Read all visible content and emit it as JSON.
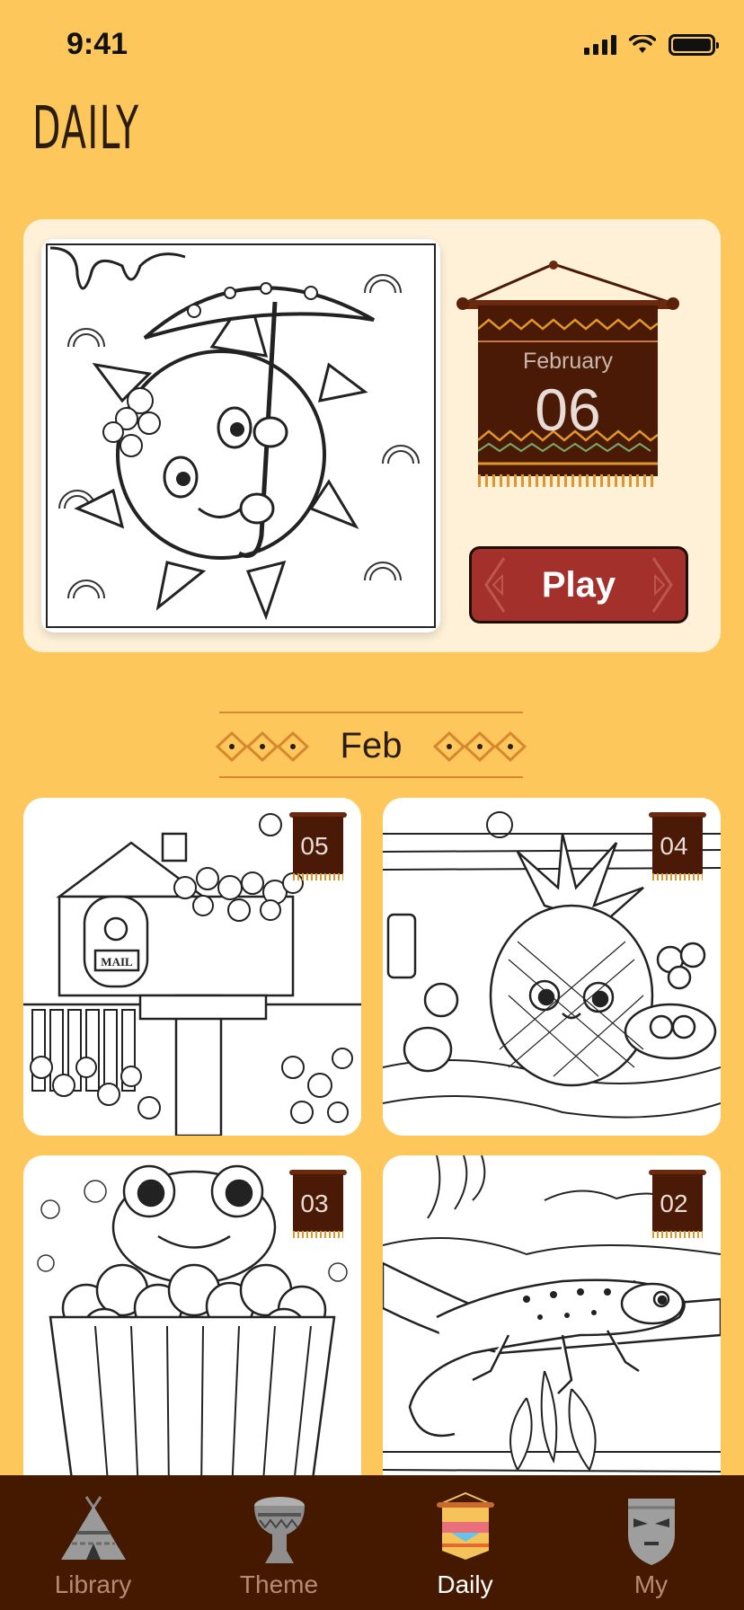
{
  "status_bar": {
    "time": "9:41"
  },
  "page": {
    "title": "DAILY"
  },
  "featured": {
    "month": "February",
    "day": "06",
    "play_label": "Play"
  },
  "section": {
    "label": "Feb"
  },
  "tiles": [
    {
      "day": "05",
      "subject": "mailbox with flowers",
      "sign_text": "MAIL"
    },
    {
      "day": "04",
      "subject": "pineapple character"
    },
    {
      "day": "03",
      "subject": "frog in popcorn"
    },
    {
      "day": "02",
      "subject": "gecko on branch"
    }
  ],
  "tabs": [
    {
      "label": "Library",
      "icon": "tent-icon",
      "active": false
    },
    {
      "label": "Theme",
      "icon": "drum-icon",
      "active": false
    },
    {
      "label": "Daily",
      "icon": "banner-icon",
      "active": true
    },
    {
      "label": "My",
      "icon": "mask-icon",
      "active": false
    }
  ],
  "colors": {
    "background": "#FDC75B",
    "card": "#FFF1D8",
    "banner": "#4a1a06",
    "play": "#A3302A",
    "tab_bar": "#451800"
  }
}
